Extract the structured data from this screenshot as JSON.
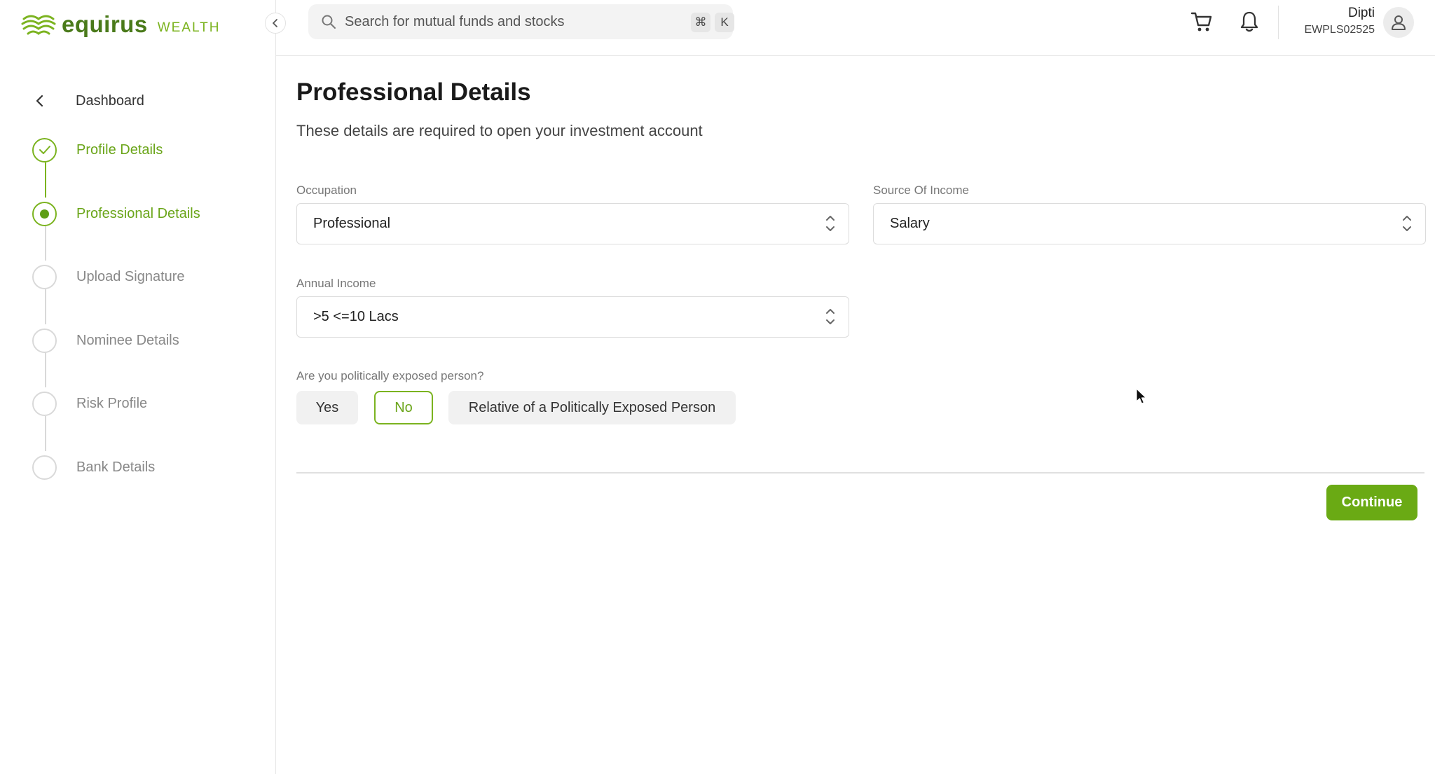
{
  "brand": {
    "name": "equirus",
    "suffix": "WEALTH",
    "accent": "#6aaa14"
  },
  "header": {
    "search_placeholder": "Search for mutual funds and stocks",
    "shortcut_mod": "⌘",
    "shortcut_key": "K",
    "user_name": "Dipti",
    "user_id": "EWPLS02525"
  },
  "sidebar": {
    "back_label": "Dashboard",
    "steps": [
      {
        "label": "Profile Details",
        "status": "done"
      },
      {
        "label": "Professional Details",
        "status": "active"
      },
      {
        "label": "Upload Signature",
        "status": "pending"
      },
      {
        "label": "Nominee Details",
        "status": "pending"
      },
      {
        "label": "Risk Profile",
        "status": "pending"
      },
      {
        "label": "Bank Details",
        "status": "pending"
      }
    ]
  },
  "main": {
    "title": "Professional Details",
    "subtitle": "These details are required to open your investment account",
    "occupation": {
      "label": "Occupation",
      "value": "Professional"
    },
    "source_of_income": {
      "label": "Source Of Income",
      "value": "Salary"
    },
    "annual_income": {
      "label": "Annual Income",
      "value": ">5 <=10 Lacs"
    },
    "pep": {
      "question": "Are you politically exposed person?",
      "options": [
        "Yes",
        "No",
        "Relative of a Politically Exposed Person"
      ],
      "selected": "No"
    },
    "continue_label": "Continue"
  }
}
